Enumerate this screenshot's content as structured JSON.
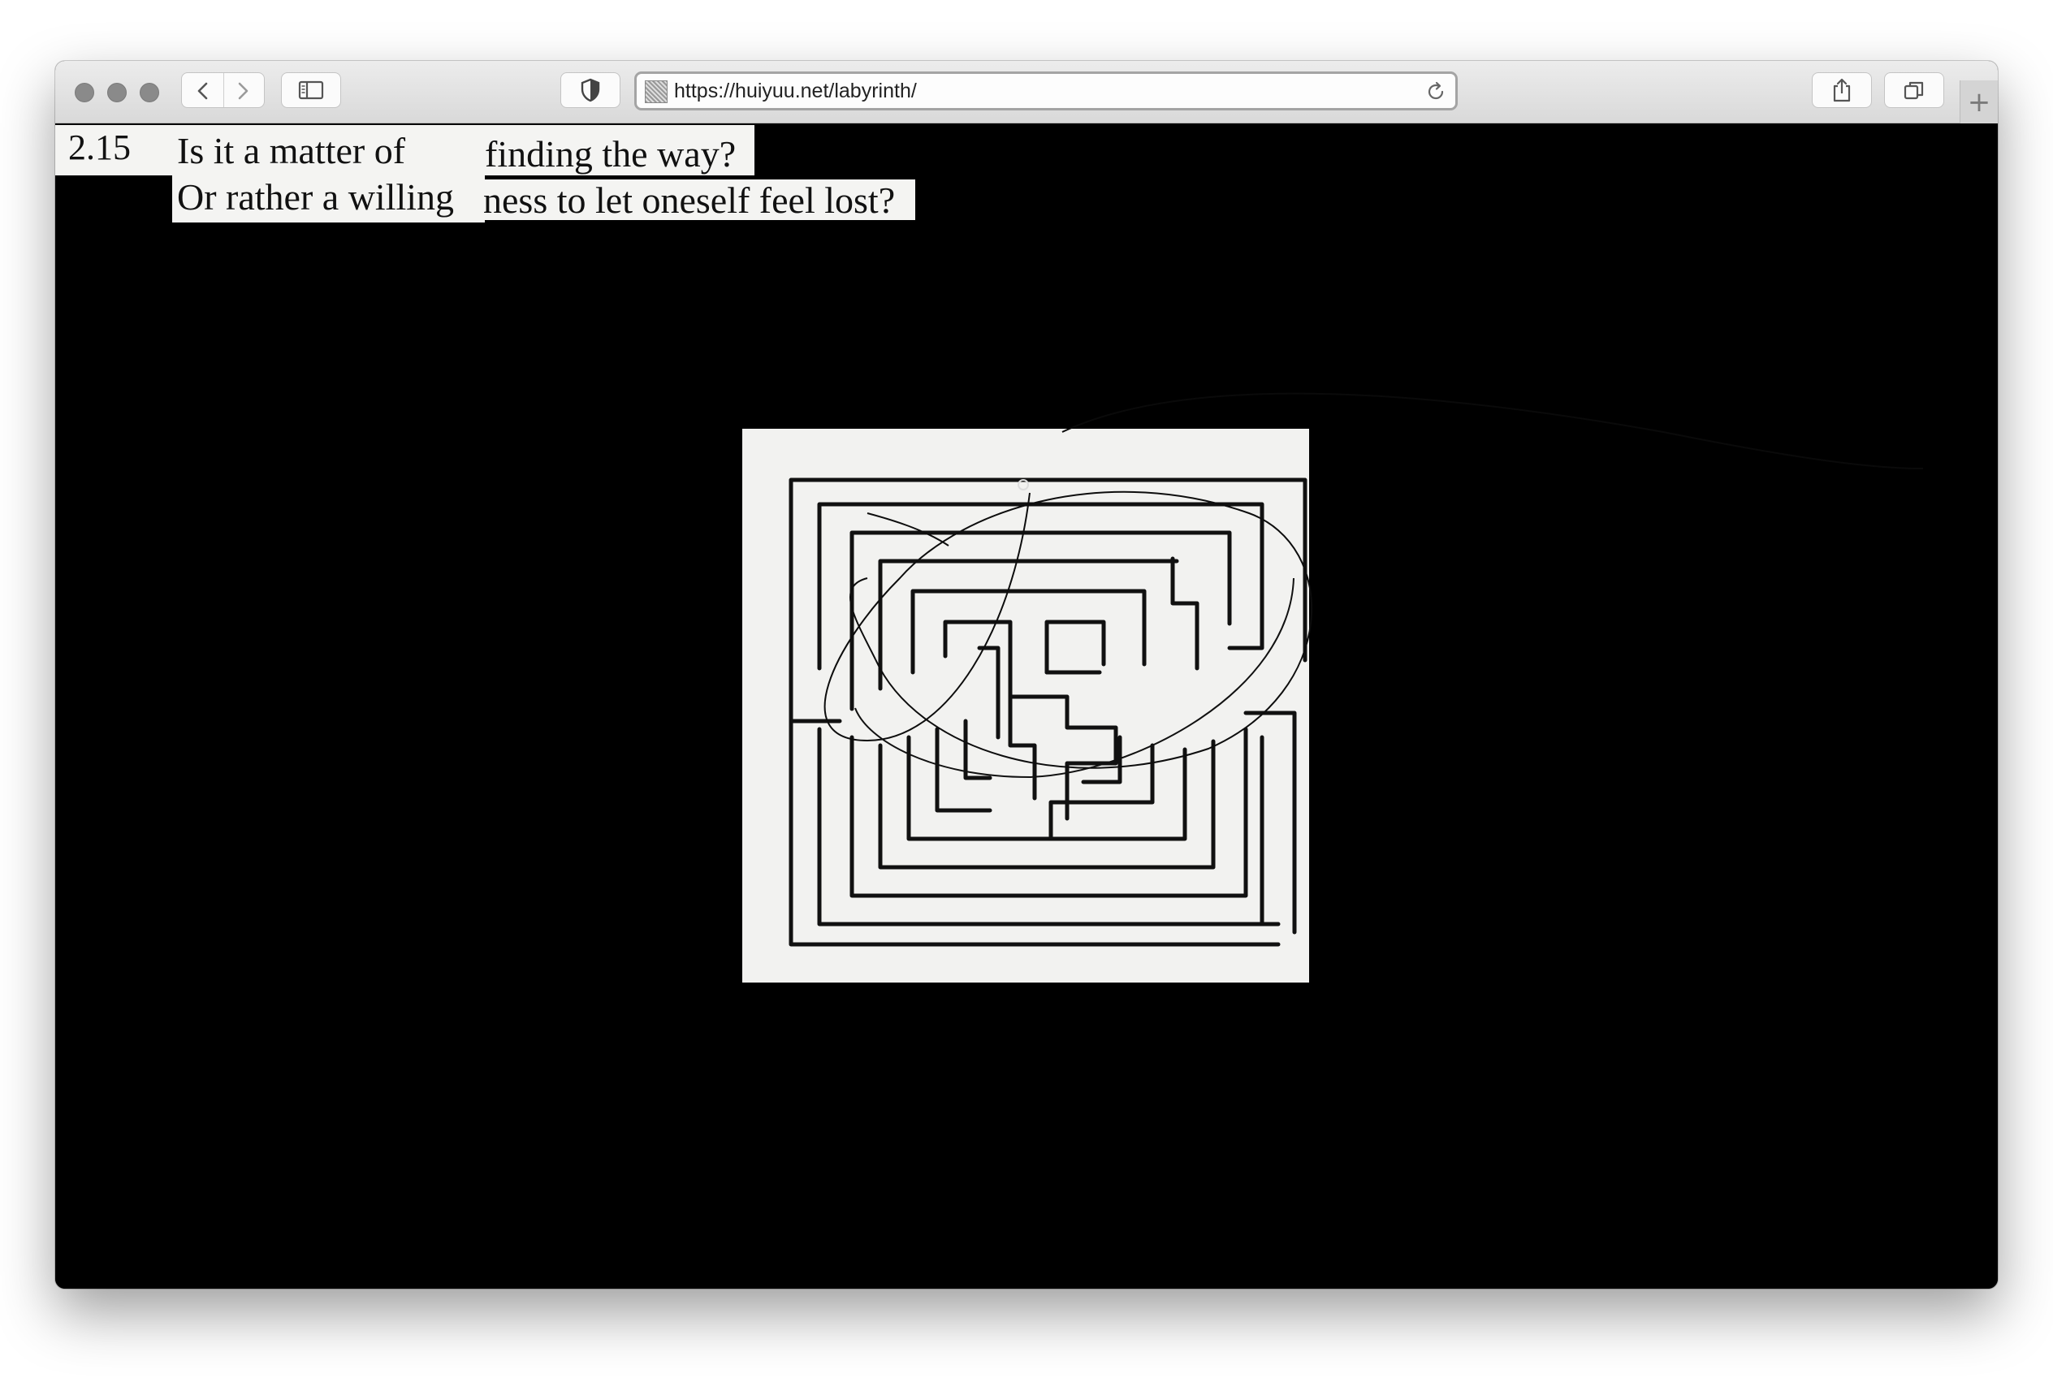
{
  "browser": {
    "url": "https://huiyuu.net/labyrinth/",
    "new_tab_label": "+"
  },
  "icons": {
    "back": "chevron-left-icon",
    "forward": "chevron-right-icon",
    "sidebar": "sidebar-icon",
    "privacy": "shield-icon",
    "reload": "reload-icon",
    "share": "share-icon",
    "tabs": "tabs-overview-icon"
  },
  "page": {
    "number": "2.15",
    "line1_a": "Is it a matter of ",
    "line1_b": "finding the way?",
    "line2_a": "Or rather a willing",
    "line2_b": "ness to let oneself feel lost?"
  },
  "colors": {
    "background": "#000000",
    "paper": "#f4f4f2",
    "chrome": "#e3e3e3"
  }
}
